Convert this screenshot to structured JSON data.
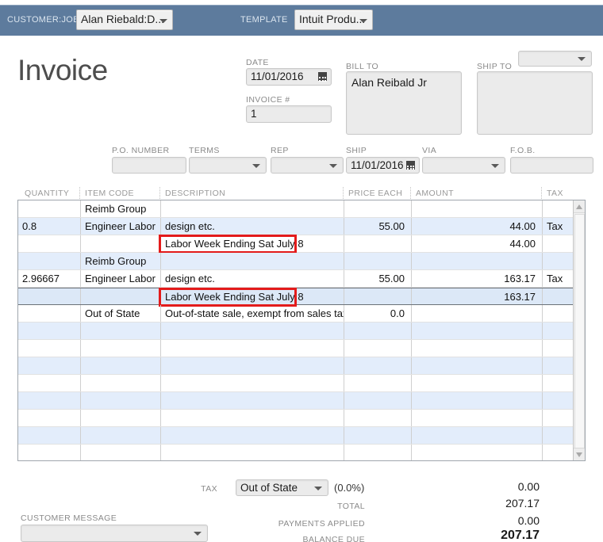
{
  "topbar": {
    "customer_job_label": "CUSTOMER:JOB",
    "customer_job_value": "Alan Riebald:D...",
    "template_label": "TEMPLATE",
    "template_value": "Intuit Produ...",
    "bar_color": "#5d7b9d"
  },
  "page_title": "Invoice",
  "header_fields": {
    "date_label": "DATE",
    "date_value": "11/01/2016",
    "invoice_num_label": "INVOICE #",
    "invoice_num_value": "1",
    "bill_to_label": "BILL TO",
    "bill_to_value": "Alan Reibald Jr",
    "ship_to_label": "SHIP TO",
    "ship_to_value": "",
    "ship_to_select_value": ""
  },
  "detail_fields": [
    {
      "label": "P.O. NUMBER",
      "value": "",
      "type": "text"
    },
    {
      "label": "TERMS",
      "value": "",
      "type": "select"
    },
    {
      "label": "REP",
      "value": "",
      "type": "select"
    },
    {
      "label": "SHIP",
      "value": "11/01/2016",
      "type": "date"
    },
    {
      "label": "VIA",
      "value": "",
      "type": "select"
    },
    {
      "label": "F.O.B.",
      "value": "",
      "type": "text"
    }
  ],
  "table": {
    "columns": [
      "QUANTITY",
      "ITEM CODE",
      "DESCRIPTION",
      "PRICE EACH",
      "AMOUNT",
      "TAX"
    ],
    "rows": [
      {
        "quantity": "",
        "item_code": "Reimb Group",
        "description": "",
        "price_each": "",
        "amount": "",
        "tax": "",
        "shade": "white",
        "selected": false,
        "highlight": false
      },
      {
        "quantity": "0.8",
        "item_code": "Engineer Labor",
        "description": "design etc.",
        "price_each": "55.00",
        "amount": "44.00",
        "tax": "Tax",
        "shade": "alt",
        "selected": false,
        "highlight": false
      },
      {
        "quantity": "",
        "item_code": "",
        "description": "Labor Week Ending Sat July 8",
        "price_each": "",
        "amount": "44.00",
        "tax": "",
        "shade": "white",
        "selected": false,
        "highlight": true
      },
      {
        "quantity": "",
        "item_code": "Reimb Group",
        "description": "",
        "price_each": "",
        "amount": "",
        "tax": "",
        "shade": "alt",
        "selected": false,
        "highlight": false
      },
      {
        "quantity": "2.96667",
        "item_code": "Engineer Labor",
        "description": "design etc.",
        "price_each": "55.00",
        "amount": "163.17",
        "tax": "Tax",
        "shade": "white",
        "selected": false,
        "highlight": false
      },
      {
        "quantity": "",
        "item_code": "",
        "description": "Labor Week Ending Sat July 8",
        "price_each": "",
        "amount": "163.17",
        "tax": "",
        "shade": "alt",
        "selected": true,
        "highlight": true
      },
      {
        "quantity": "",
        "item_code": "Out of State",
        "description": "Out-of-state sale, exempt from sales tax",
        "price_each": "0.0",
        "amount": "",
        "tax": "",
        "shade": "white",
        "selected": false,
        "highlight": false
      },
      {
        "quantity": "",
        "item_code": "",
        "description": "",
        "price_each": "",
        "amount": "",
        "tax": "",
        "shade": "alt",
        "selected": false,
        "highlight": false
      },
      {
        "quantity": "",
        "item_code": "",
        "description": "",
        "price_each": "",
        "amount": "",
        "tax": "",
        "shade": "white",
        "selected": false,
        "highlight": false
      },
      {
        "quantity": "",
        "item_code": "",
        "description": "",
        "price_each": "",
        "amount": "",
        "tax": "",
        "shade": "alt",
        "selected": false,
        "highlight": false
      },
      {
        "quantity": "",
        "item_code": "",
        "description": "",
        "price_each": "",
        "amount": "",
        "tax": "",
        "shade": "white",
        "selected": false,
        "highlight": false
      },
      {
        "quantity": "",
        "item_code": "",
        "description": "",
        "price_each": "",
        "amount": "",
        "tax": "",
        "shade": "alt",
        "selected": false,
        "highlight": false
      },
      {
        "quantity": "",
        "item_code": "",
        "description": "",
        "price_each": "",
        "amount": "",
        "tax": "",
        "shade": "white",
        "selected": false,
        "highlight": false
      },
      {
        "quantity": "",
        "item_code": "",
        "description": "",
        "price_each": "",
        "amount": "",
        "tax": "",
        "shade": "alt",
        "selected": false,
        "highlight": false
      },
      {
        "quantity": "",
        "item_code": "",
        "description": "",
        "price_each": "",
        "amount": "",
        "tax": "",
        "shade": "white",
        "selected": false,
        "highlight": false
      }
    ]
  },
  "footer": {
    "tax_label": "TAX",
    "tax_value": "Out of State",
    "tax_percent": "(0.0%)",
    "tax_amount": "0.00",
    "total_label": "TOTAL",
    "total_value": "207.17",
    "payments_label": "PAYMENTS APPLIED",
    "payments_value": "0.00",
    "balance_label": "BALANCE DUE",
    "balance_value": "207.17",
    "customer_message_label": "CUSTOMER MESSAGE",
    "customer_message_value": ""
  }
}
